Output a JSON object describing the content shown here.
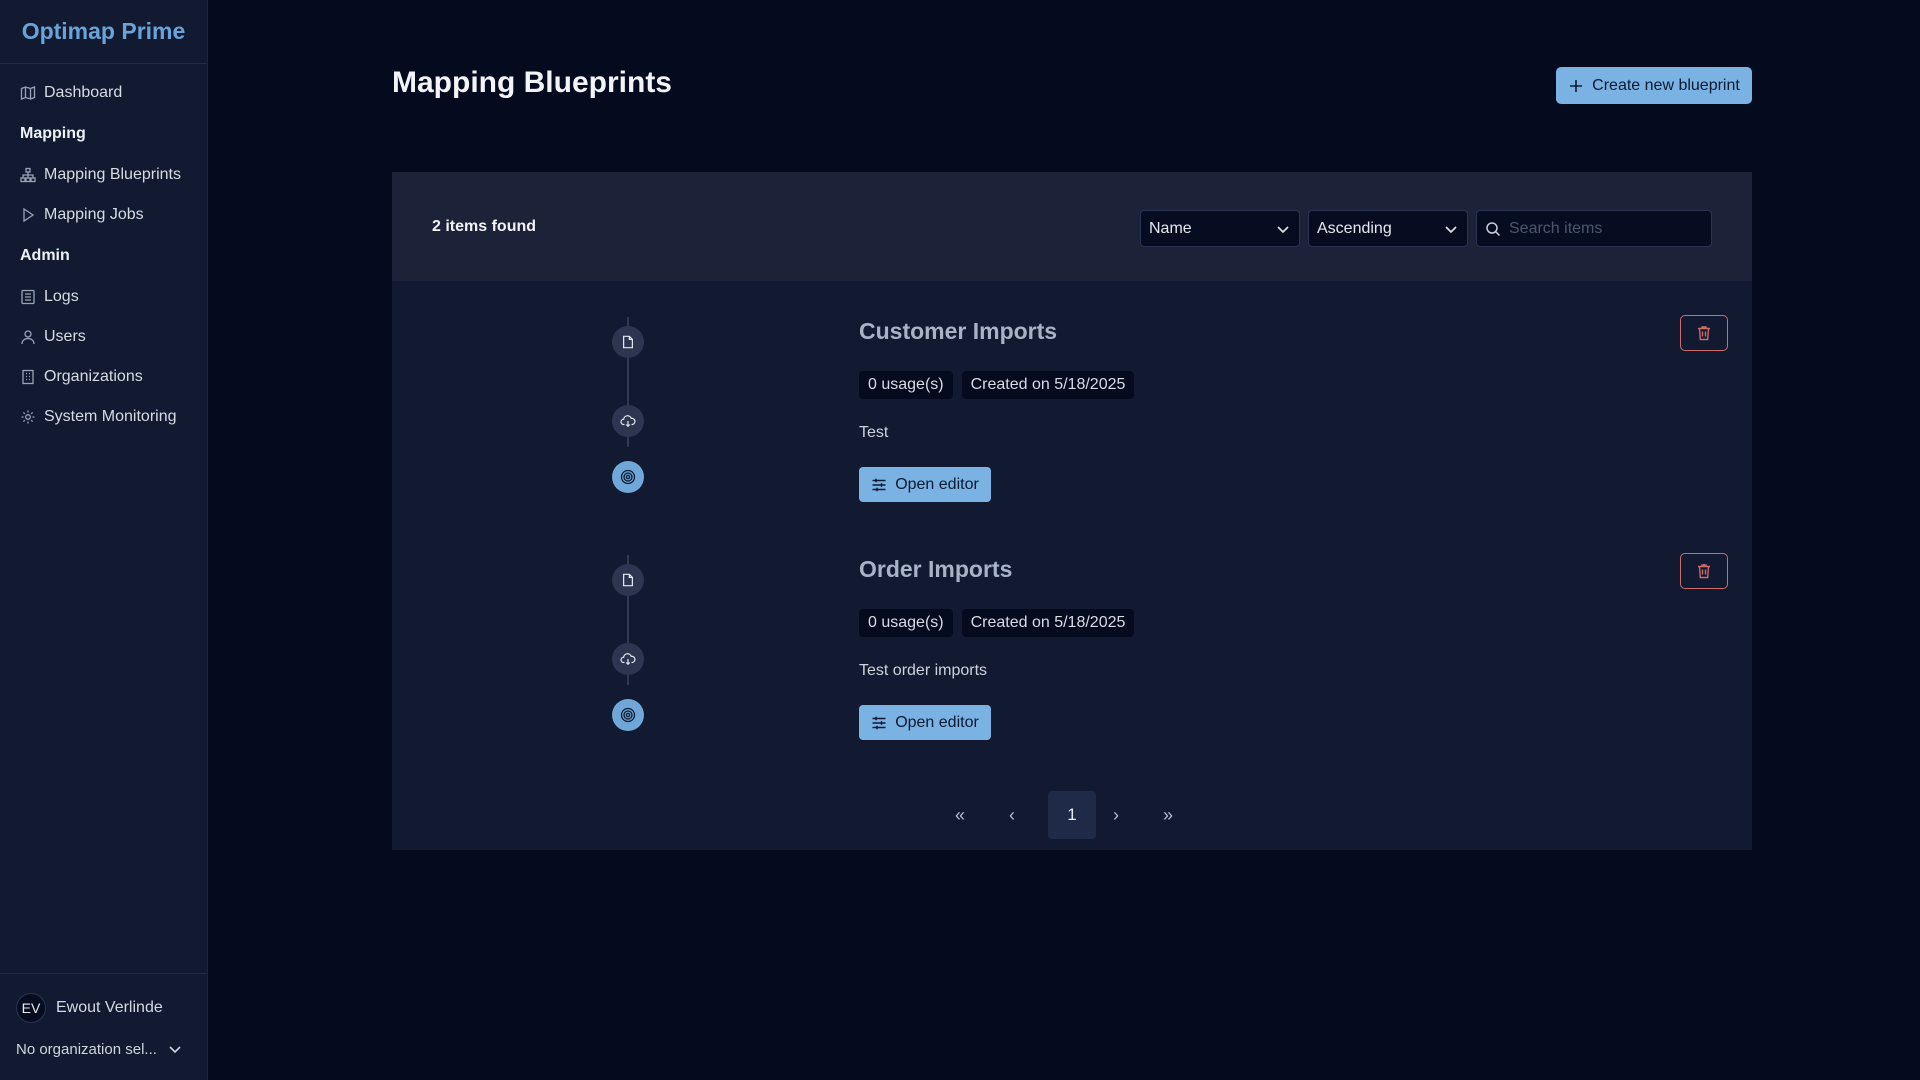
{
  "app": {
    "title": "Optimap Prime"
  },
  "sidebar": {
    "items": [
      {
        "label": "Dashboard",
        "icon": "map-icon"
      },
      {
        "section": "Mapping"
      },
      {
        "label": "Mapping Blueprints",
        "icon": "sitemap-icon"
      },
      {
        "label": "Mapping Jobs",
        "icon": "play-icon"
      },
      {
        "section": "Admin"
      },
      {
        "label": "Logs",
        "icon": "list-icon"
      },
      {
        "label": "Users",
        "icon": "user-icon"
      },
      {
        "label": "Organizations",
        "icon": "building-icon"
      },
      {
        "label": "System Monitoring",
        "icon": "gear-icon"
      }
    ],
    "user": {
      "initials": "EV",
      "name": "Ewout Verlinde"
    },
    "organization": {
      "label": "No organization sel..."
    }
  },
  "main": {
    "title": "Mapping Blueprints",
    "create_label": "Create new blueprint",
    "toolbar": {
      "count": "2 items found",
      "sort_field": "Name",
      "sort_order": "Ascending",
      "search_placeholder": "Search items"
    },
    "items": [
      {
        "title": "Customer Imports",
        "usages": "0 usage(s)",
        "created": "Created on 5/18/2025",
        "description": "Test",
        "action": "Open editor"
      },
      {
        "title": "Order Imports",
        "usages": "0 usage(s)",
        "created": "Created on 5/18/2025",
        "description": "Test order imports",
        "action": "Open editor"
      }
    ],
    "pagination": {
      "first": "«",
      "prev": "‹",
      "current": "1",
      "next": "›",
      "last": "»"
    }
  },
  "colors": {
    "accent": "#7ab3e3",
    "danger": "#d06a6a",
    "background": "#050b1f",
    "panel": "#111a30"
  }
}
